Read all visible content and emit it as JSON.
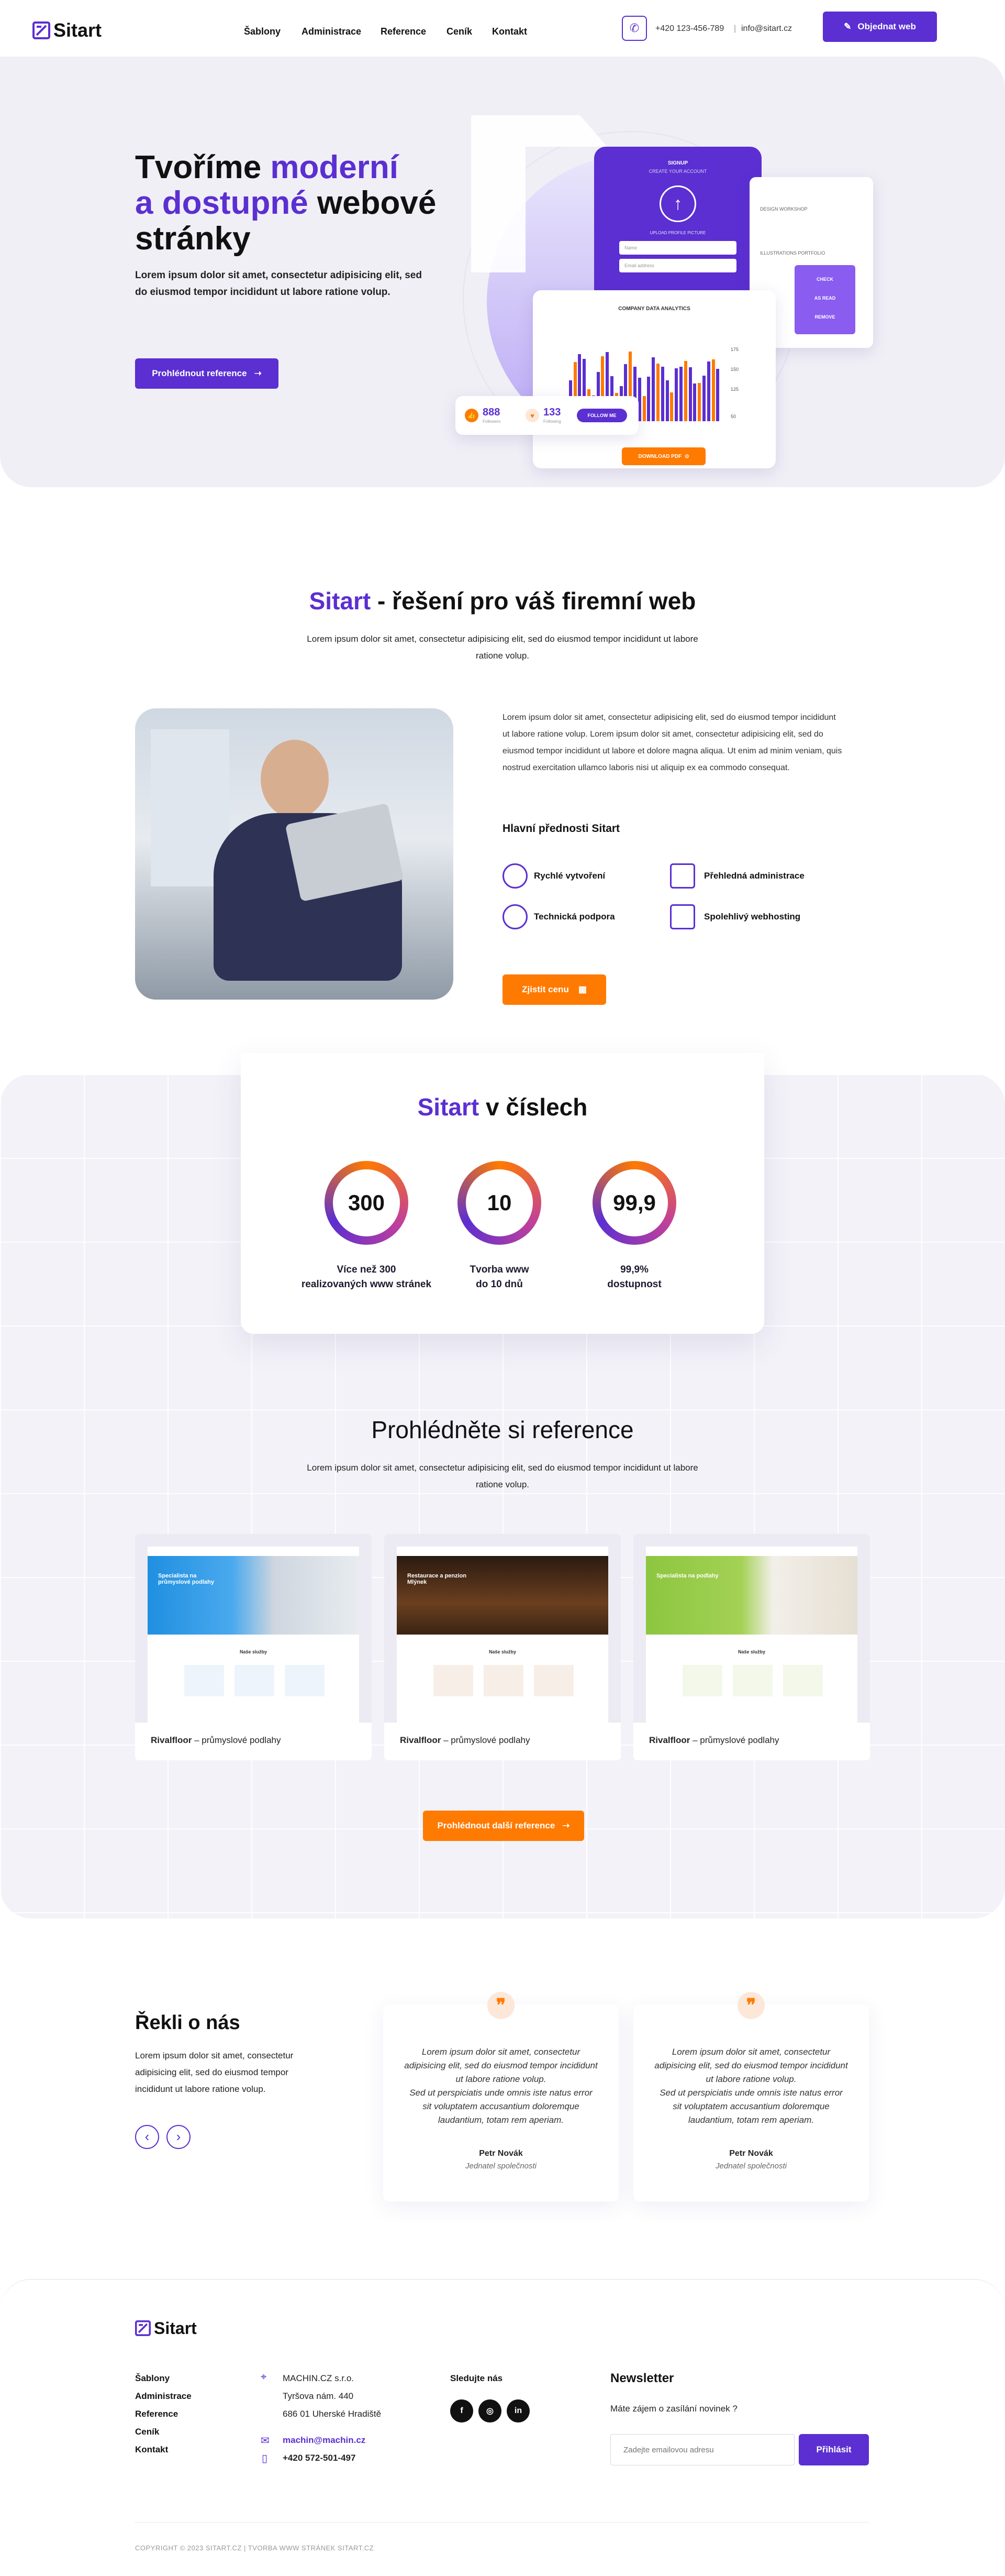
{
  "header": {
    "logo": "Sitart",
    "nav": [
      "Šablony",
      "Administrace",
      "Reference",
      "Ceník",
      "Kontakt"
    ],
    "phone": "+420 123-456-789",
    "separator": "|",
    "email": "info@sitart.cz",
    "cta": "Objednat web"
  },
  "hero": {
    "title_line1_a": "Tvoříme ",
    "title_line1_b": "moderní",
    "title_line2_a": "a dostupné",
    "title_line2_b": " webové",
    "title_line3": "stránky",
    "lead": "Lorem ipsum dolor sit amet, consectetur adipisicing elit, sed do eiusmod tempor incididunt ut labore ratione volup.",
    "button": "Prohlédnout reference",
    "mock": {
      "signup": "SIGNUP",
      "create": "CREATE YOUR ACCOUNT",
      "upload": "UPLOAD PROFILE PICTURE",
      "name": "Name",
      "email": "Email address",
      "company": "COMPANY DATA ANALYTICS",
      "likes": "888",
      "likes_label": "Followers",
      "hearts": "133",
      "hearts_label": "Following",
      "follow": "FOLLOW ME",
      "download": "DOWNLOAD PDF",
      "event1": "DESIGN WORKSHOP",
      "event2": "ILLUSTRATIONS PORTFOLIO",
      "menu": [
        "CHECK",
        "AS READ",
        "REMOVE"
      ],
      "y_ticks": [
        "175",
        "150",
        "125",
        "50"
      ]
    }
  },
  "about": {
    "title_a": "Sitart",
    "title_b": " - řešení pro váš firemní web",
    "lead": "Lorem ipsum dolor sit amet, consectetur adipisicing elit, sed do eiusmod tempor incididunt ut labore ratione volup.",
    "body": "Lorem ipsum dolor sit amet, consectetur adipisicing elit, sed do eiusmod tempor incididunt ut labore ratione volup. Lorem ipsum dolor sit amet, consectetur adipisicing elit, sed do eiusmod tempor incididunt ut labore et dolore magna aliqua. Ut enim ad minim veniam, quis nostrud exercitation ullamco laboris nisi ut aliquip ex ea commodo consequat.",
    "features_title": "Hlavní přednosti Sitart",
    "features": [
      "Rychlé vytvoření",
      "Přehledná administrace",
      "Technická podpora",
      "Spolehlivý webhosting"
    ],
    "button": "Zjistit cenu"
  },
  "stats": {
    "title_a": "Sitart",
    "title_b": " v číslech",
    "items": [
      {
        "value": "300",
        "label": "Více než 300\nrealizovaných www stránek"
      },
      {
        "value": "10",
        "label": "Tvorba www\ndo 10 dnů"
      },
      {
        "value": "99,9",
        "label": "99,9%\ndostupnost"
      }
    ]
  },
  "references": {
    "title": "Prohlédněte si reference",
    "lead": "Lorem ipsum dolor sit amet, consectetur adipisicing elit, sed do eiusmod tempor incididunt ut labore ratione volup.",
    "cards": [
      {
        "name": "Rivalfloor",
        "desc": " – průmyslové podlahy",
        "hero": "Specialista na průmyslové podlahy",
        "section": "Naše služby"
      },
      {
        "name": "Rivalfloor",
        "desc": " – průmyslové podlahy",
        "hero": "Restaurace a penzion Mlýnek",
        "section": "Naše služby"
      },
      {
        "name": "Rivalfloor",
        "desc": " – průmyslové podlahy",
        "hero": "Specialista na podlahy",
        "section": "Naše služby"
      }
    ],
    "button": "Prohlédnout další reference"
  },
  "testimonials": {
    "title": "Řekli o nás",
    "lead": "Lorem ipsum dolor sit amet, consectetur adipisicing elit, sed do eiusmod tempor incididunt ut labore ratione volup.",
    "prev": "‹",
    "next": "›",
    "items": [
      {
        "quote": "Lorem ipsum dolor sit amet, consectetur adipisicing elit, sed do eiusmod tempor incididunt ut labore ratione volup.\nSed ut perspiciatis unde omnis iste natus error sit voluptatem accusantium doloremque laudantium, totam rem aperiam.",
        "name": "Petr Novák",
        "role": "Jednatel společnosti"
      },
      {
        "quote": "Lorem ipsum dolor sit amet, consectetur adipisicing elit, sed do eiusmod tempor incididunt ut labore ratione volup.\nSed ut perspiciatis unde omnis iste natus error sit voluptatem accusantium doloremque laudantium, totam rem aperiam.",
        "name": "Petr Novák",
        "role": "Jednatel společnosti"
      }
    ]
  },
  "footer": {
    "logo": "Sitart",
    "links": [
      "Šablony",
      "Administrace",
      "Reference",
      "Ceník",
      "Kontakt"
    ],
    "company": "MACHIN.CZ s.r.o.",
    "street": "Tyršova nám. 440",
    "city": "686 01 Uherské Hradiště",
    "email": "machin@machin.cz",
    "phone": "+420 572-501-497",
    "follow": "Sledujte nás",
    "newsletter_title": "Newsletter",
    "newsletter_lead": "Máte zájem o zasílání novinek ?",
    "newsletter_placeholder": "Zadejte emailovou adresu",
    "newsletter_button": "Přihlásit",
    "copyright": "COPYRIGHT © 2023 SITART.CZ  |  TVORBA WWW STRÁNEK SITART.CZ"
  },
  "colors": {
    "purple": "#5b2fd1",
    "orange": "#ff7a00",
    "light_bg": "#f3f2f8"
  }
}
